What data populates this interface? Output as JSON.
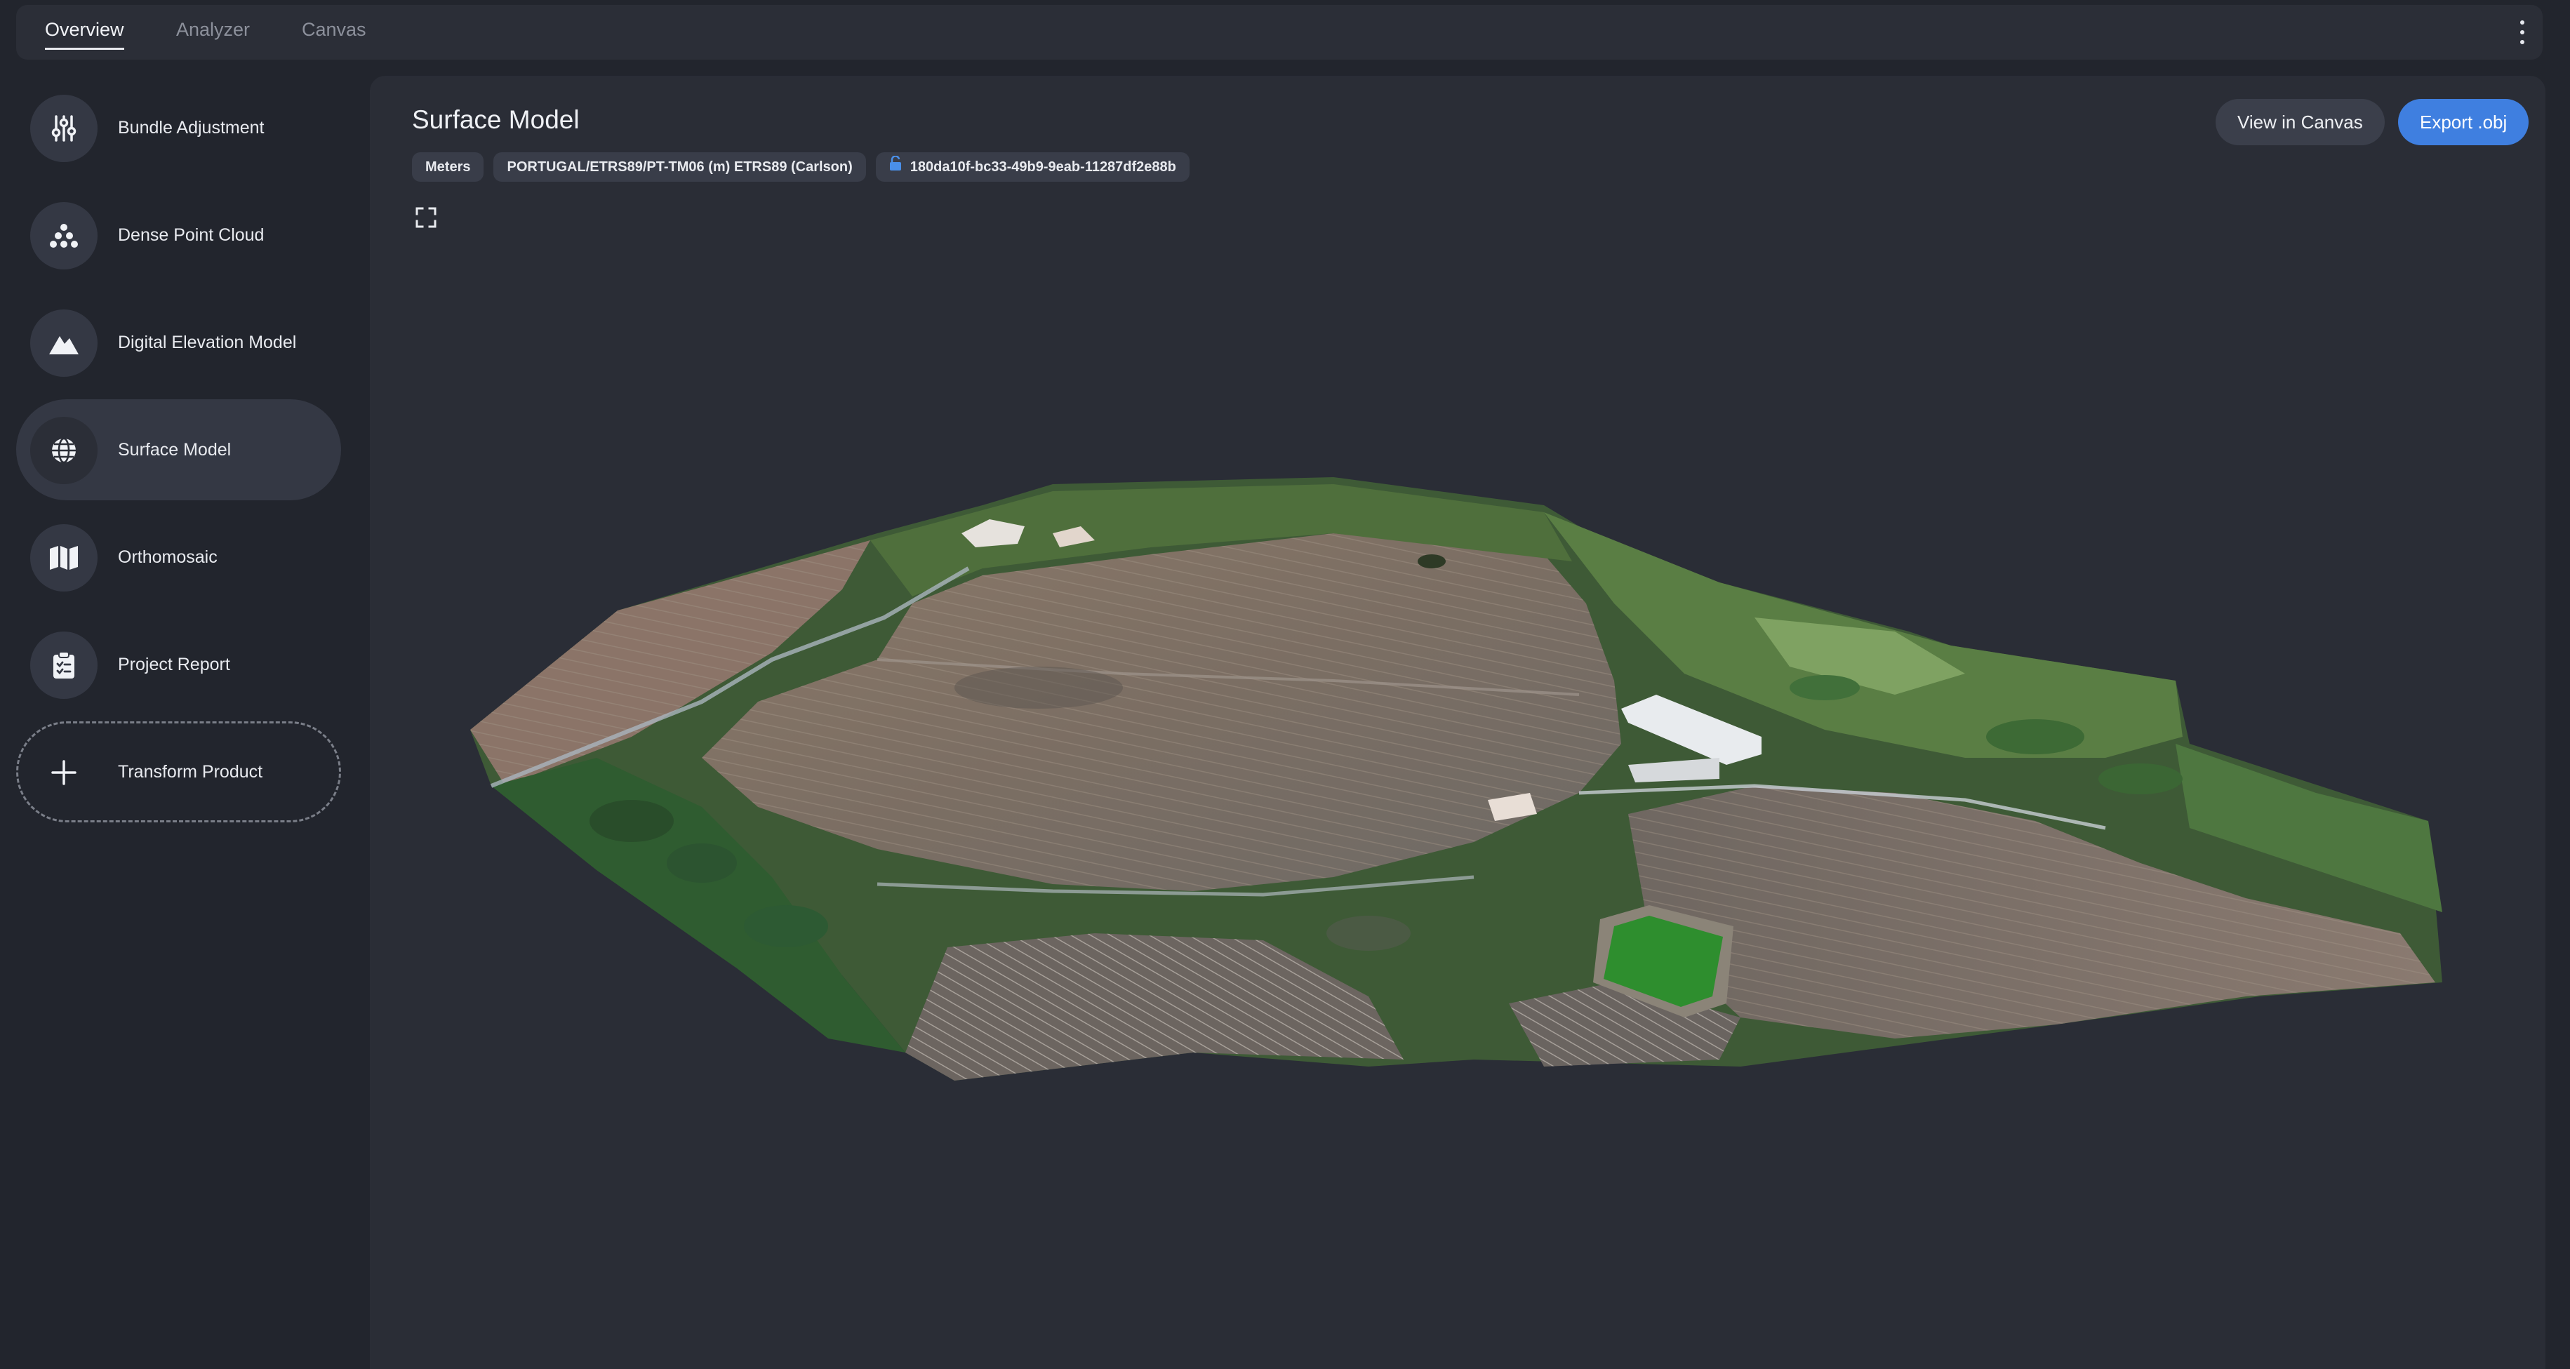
{
  "topbar": {
    "tabs": [
      {
        "label": "Overview",
        "active": true
      },
      {
        "label": "Analyzer",
        "active": false
      },
      {
        "label": "Canvas",
        "active": false
      }
    ],
    "menu_icon": "more-vertical-icon"
  },
  "sidebar": {
    "items": [
      {
        "label": "Bundle Adjustment",
        "icon": "sliders-icon"
      },
      {
        "label": "Dense Point Cloud",
        "icon": "point-cloud-icon"
      },
      {
        "label": "Digital Elevation Model",
        "icon": "mountain-icon"
      },
      {
        "label": "Surface Model",
        "icon": "globe-icon",
        "active": true
      },
      {
        "label": "Orthomosaic",
        "icon": "map-icon"
      },
      {
        "label": "Project Report",
        "icon": "clipboard-icon"
      },
      {
        "label": "Transform Product",
        "icon": "plus-icon"
      }
    ]
  },
  "main": {
    "title": "Surface Model",
    "chips": {
      "units": "Meters",
      "crs": "PORTUGAL/ETRS89/PT-TM06 (m) ETRS89 (Carlson)",
      "id": "180da10f-bc33-49b9-9eab-11287df2e88b",
      "id_icon": "unlock-icon"
    },
    "buttons": {
      "view_in_canvas": "View in Canvas",
      "export": "Export .obj"
    },
    "expand_icon": "fullscreen-icon",
    "viewport_content": "3d-terrain-surface-model"
  },
  "colors": {
    "background": "#22252d",
    "panel": "#2a2d36",
    "accent": "#3f7fe0",
    "chip_icon": "#4a8fe8"
  }
}
